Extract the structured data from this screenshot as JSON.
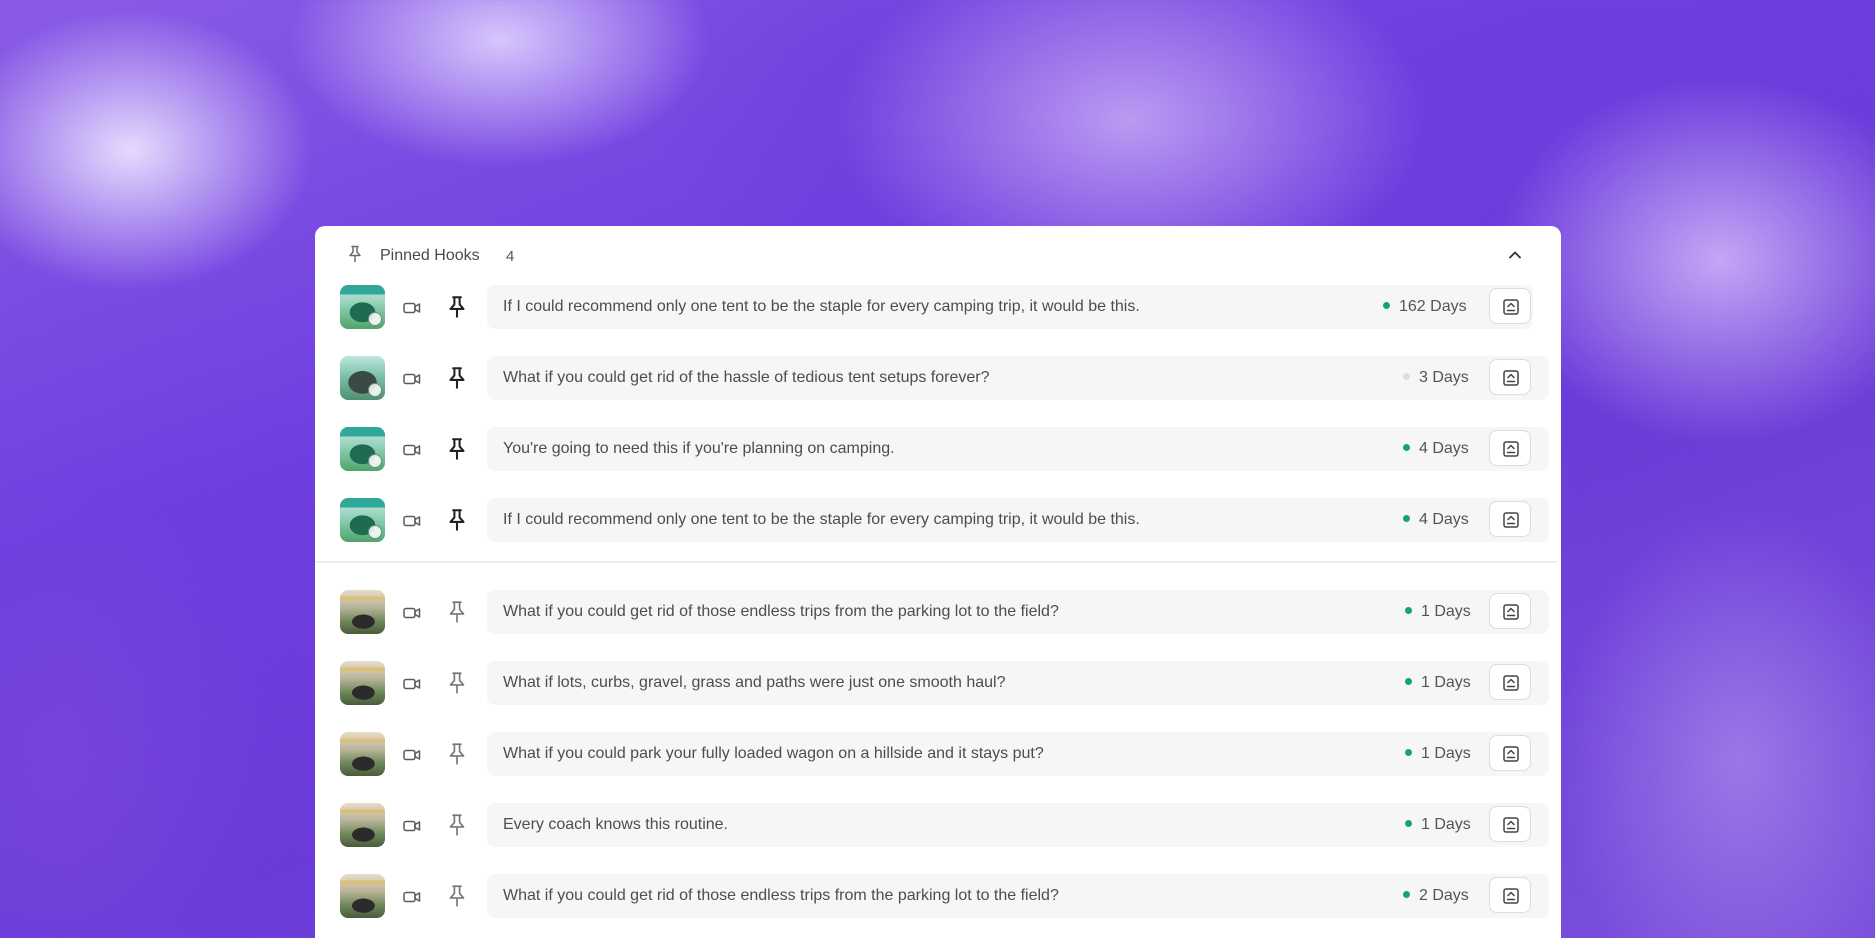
{
  "header": {
    "title": "Pinned Hooks",
    "count": "4"
  },
  "colors": {
    "active_dot": "#12a37a",
    "inactive_dot": "#dedede"
  },
  "hooks": [
    {
      "thumbnail": "tent-video-thumbnail",
      "text": "If I could recommend only one tent to be the staple for every camping trip, it would be this.",
      "age": "162 Days",
      "status": "active",
      "pinned": true
    },
    {
      "thumbnail": "tent-video-thumbnail",
      "text": "What if you could get rid of the hassle of tedious tent setups forever?",
      "age": "3 Days",
      "status": "inactive",
      "pinned": true
    },
    {
      "thumbnail": "tent-video-thumbnail",
      "text": "You're going to need this if you're planning on camping.",
      "age": "4 Days",
      "status": "active",
      "pinned": true
    },
    {
      "thumbnail": "tent-video-thumbnail",
      "text": "If I could recommend only one tent to be the staple for every camping trip, it would be this.",
      "age": "4 Days",
      "status": "active",
      "pinned": true
    },
    {
      "thumbnail": "wagon-video-thumbnail",
      "text": "What if you could get rid of those endless trips from the parking lot to the field?",
      "age": "1 Days",
      "status": "active",
      "pinned": false
    },
    {
      "thumbnail": "wagon-video-thumbnail",
      "text": "What if lots, curbs, gravel, grass and paths were just one smooth haul?",
      "age": "1 Days",
      "status": "active",
      "pinned": false
    },
    {
      "thumbnail": "wagon-video-thumbnail",
      "text": "What if you could park your fully loaded wagon on a hillside and it stays put?",
      "age": "1 Days",
      "status": "active",
      "pinned": false
    },
    {
      "thumbnail": "wagon-video-thumbnail",
      "text": "Every coach knows this routine.",
      "age": "1 Days",
      "status": "active",
      "pinned": false
    },
    {
      "thumbnail": "wagon-video-thumbnail",
      "text": "What if you could get rid of those endless trips from the parking lot to the field?",
      "age": "2 Days",
      "status": "active",
      "pinned": false
    }
  ]
}
